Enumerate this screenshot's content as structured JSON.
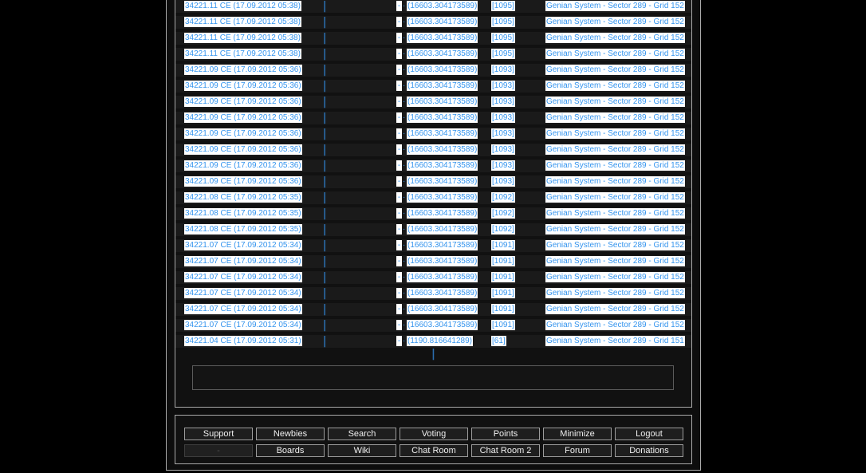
{
  "colors": {
    "link_blue": "#3494ee",
    "selection_bg": "#ffffff",
    "pipe_blue": "#2b6dad"
  },
  "log": {
    "markers": {
      "pipe": "|",
      "dash": "-",
      "dot": "·"
    },
    "pager_separator": "|",
    "rows": [
      {
        "time": "34221.11 CE (17.09.2012 05:38)",
        "coord": "(16603.304173589)",
        "count": "[1095]",
        "location": "Genian System - Sector 289 - Grid 152"
      },
      {
        "time": "34221.11 CE (17.09.2012 05:38)",
        "coord": "(16603.304173589)",
        "count": "[1095]",
        "location": "Genian System - Sector 289 - Grid 152"
      },
      {
        "time": "34221.11 CE (17.09.2012 05:38)",
        "coord": "(16603.304173589)",
        "count": "[1095]",
        "location": "Genian System - Sector 289 - Grid 152"
      },
      {
        "time": "34221.11 CE (17.09.2012 05:38)",
        "coord": "(16603.304173589)",
        "count": "[1095]",
        "location": "Genian System - Sector 289 - Grid 152"
      },
      {
        "time": "34221.09 CE (17.09.2012 05:36)",
        "coord": "(16603.304173589)",
        "count": "[1093]",
        "location": "Genian System - Sector 289 - Grid 152"
      },
      {
        "time": "34221.09 CE (17.09.2012 05:36)",
        "coord": "(16603.304173589)",
        "count": "[1093]",
        "location": "Genian System - Sector 289 - Grid 152"
      },
      {
        "time": "34221.09 CE (17.09.2012 05:36)",
        "coord": "(16603.304173589)",
        "count": "[1093]",
        "location": "Genian System - Sector 289 - Grid 152"
      },
      {
        "time": "34221.09 CE (17.09.2012 05:36)",
        "coord": "(16603.304173589)",
        "count": "[1093]",
        "location": "Genian System - Sector 289 - Grid 152"
      },
      {
        "time": "34221.09 CE (17.09.2012 05:36)",
        "coord": "(16603.304173589)",
        "count": "[1093]",
        "location": "Genian System - Sector 289 - Grid 152"
      },
      {
        "time": "34221.09 CE (17.09.2012 05:36)",
        "coord": "(16603.304173589)",
        "count": "[1093]",
        "location": "Genian System - Sector 289 - Grid 152"
      },
      {
        "time": "34221.09 CE (17.09.2012 05:36)",
        "coord": "(16603.304173589)",
        "count": "[1093]",
        "location": "Genian System - Sector 289 - Grid 152"
      },
      {
        "time": "34221.09 CE (17.09.2012 05:36)",
        "coord": "(16603.304173589)",
        "count": "[1093]",
        "location": "Genian System - Sector 289 - Grid 152"
      },
      {
        "time": "34221.08 CE (17.09.2012 05:35)",
        "coord": "(16603.304173589)",
        "count": "[1092]",
        "location": "Genian System - Sector 289 - Grid 152"
      },
      {
        "time": "34221.08 CE (17.09.2012 05:35)",
        "coord": "(16603.304173589)",
        "count": "[1092]",
        "location": "Genian System - Sector 289 - Grid 152"
      },
      {
        "time": "34221.08 CE (17.09.2012 05:35)",
        "coord": "(16603.304173589)",
        "count": "[1092]",
        "location": "Genian System - Sector 289 - Grid 152"
      },
      {
        "time": "34221.07 CE (17.09.2012 05:34)",
        "coord": "(16603.304173589)",
        "count": "[1091]",
        "location": "Genian System - Sector 289 - Grid 152"
      },
      {
        "time": "34221.07 CE (17.09.2012 05:34)",
        "coord": "(16603.304173589)",
        "count": "[1091]",
        "location": "Genian System - Sector 289 - Grid 152"
      },
      {
        "time": "34221.07 CE (17.09.2012 05:34)",
        "coord": "(16603.304173589)",
        "count": "[1091]",
        "location": "Genian System - Sector 289 - Grid 152"
      },
      {
        "time": "34221.07 CE (17.09.2012 05:34)",
        "coord": "(16603.304173589)",
        "count": "[1091]",
        "location": "Genian System - Sector 289 - Grid 152"
      },
      {
        "time": "34221.07 CE (17.09.2012 05:34)",
        "coord": "(16603.304173589)",
        "count": "[1091]",
        "location": "Genian System - Sector 289 - Grid 152"
      },
      {
        "time": "34221.07 CE (17.09.2012 05:34)",
        "coord": "(16603.304173589)",
        "count": "[1091]",
        "location": "Genian System - Sector 289 - Grid 152"
      },
      {
        "time": "34221.04 CE (17.09.2012 05:31)",
        "coord": "(1190.816641289)",
        "count": "[61]",
        "location": "Genian System - Sector 289 - Grid 151"
      }
    ]
  },
  "input": {
    "value": "",
    "placeholder": ""
  },
  "footer": {
    "buttons": [
      {
        "label": "Support"
      },
      {
        "label": "Newbies"
      },
      {
        "label": "Search"
      },
      {
        "label": "Voting"
      },
      {
        "label": "Points"
      },
      {
        "label": "Minimize"
      },
      {
        "label": "Logout"
      },
      {
        "label": "-",
        "disabled": true
      },
      {
        "label": "Boards"
      },
      {
        "label": "Wiki"
      },
      {
        "label": "Chat Room"
      },
      {
        "label": "Chat Room 2"
      },
      {
        "label": "Forum"
      },
      {
        "label": "Donations"
      }
    ]
  }
}
